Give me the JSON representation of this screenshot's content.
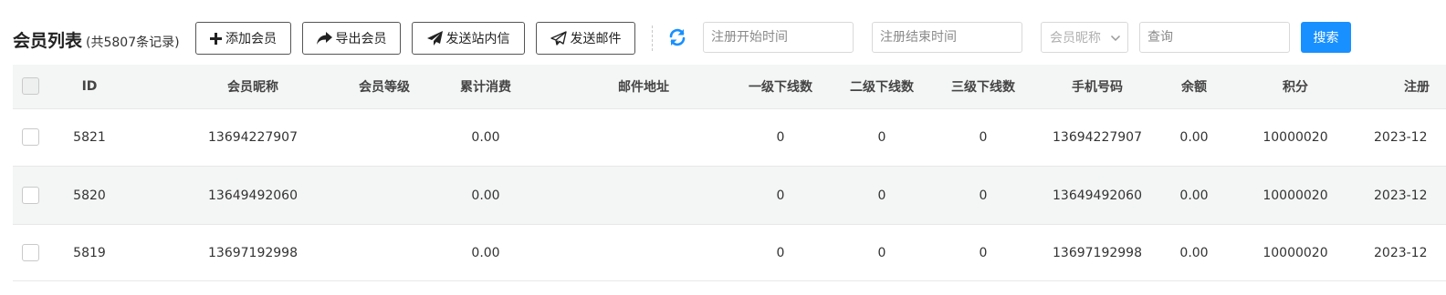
{
  "header": {
    "title": "会员列表",
    "count_text": "(共5807条记录)"
  },
  "toolbar": {
    "add_label": "添加会员",
    "export_label": "导出会员",
    "send_message_label": "发送站内信",
    "send_email_label": "发送邮件",
    "icons": {
      "add": "plus-icon",
      "export": "share-arrow-icon",
      "send_message": "paper-plane-filled-icon",
      "send_email": "paper-plane-outline-icon",
      "refresh": "refresh-icon"
    },
    "refresh_color": "#1890ff"
  },
  "filters": {
    "reg_start_placeholder": "注册开始时间",
    "reg_end_placeholder": "注册结束时间",
    "field_select_value": "会员昵称",
    "query_placeholder": "查询",
    "search_label": "搜索",
    "search_color": "#1890ff"
  },
  "table": {
    "columns": [
      "ID",
      "会员昵称",
      "会员等级",
      "累计消费",
      "邮件地址",
      "一级下线数",
      "二级下线数",
      "三级下线数",
      "手机号码",
      "余额",
      "积分",
      "注册"
    ],
    "rows": [
      [
        "5821",
        "13694227907",
        "",
        "0.00",
        "",
        "0",
        "0",
        "0",
        "13694227907",
        "0.00",
        "10000020",
        "2023-12"
      ],
      [
        "5820",
        "13649492060",
        "",
        "0.00",
        "",
        "0",
        "0",
        "0",
        "13649492060",
        "0.00",
        "10000020",
        "2023-12"
      ],
      [
        "5819",
        "13697192998",
        "",
        "0.00",
        "",
        "0",
        "0",
        "0",
        "13697192998",
        "0.00",
        "10000020",
        "2023-12"
      ]
    ]
  }
}
